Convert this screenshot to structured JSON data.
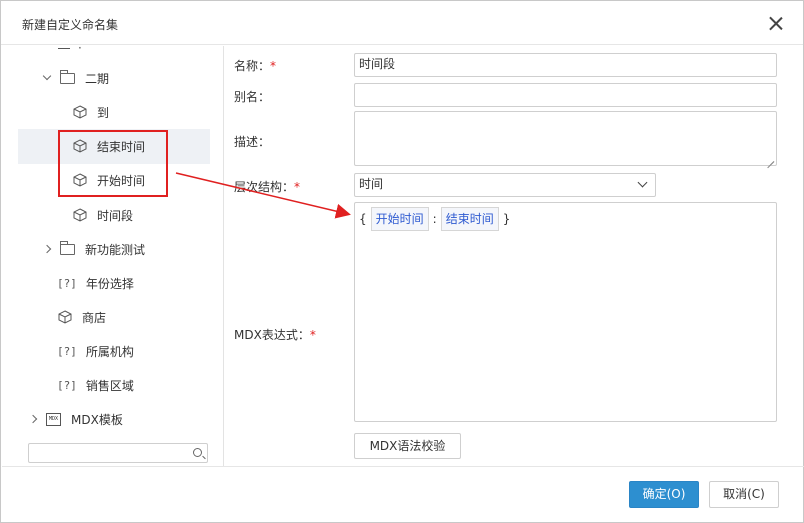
{
  "dialog": {
    "title": "新建自定义命名集",
    "close_label": "×"
  },
  "tree": {
    "items": [
      {
        "label": "二期",
        "icon": "folder-icon",
        "expanded": true
      },
      {
        "label": "到",
        "icon": "cube-icon"
      },
      {
        "label": "结束时间",
        "icon": "cube-icon",
        "selected": true
      },
      {
        "label": "开始时间",
        "icon": "cube-icon"
      },
      {
        "label": "时间段",
        "icon": "cube-icon"
      },
      {
        "label": "新功能测试",
        "icon": "folder-icon",
        "expanded": false
      },
      {
        "label": "年份选择",
        "icon": "question-mark-icon",
        "icon_text": "[?]"
      },
      {
        "label": "商店",
        "icon": "cube-icon"
      },
      {
        "label": "所属机构",
        "icon": "question-mark-icon",
        "icon_text": "[?]"
      },
      {
        "label": "销售区域",
        "icon": "question-mark-icon",
        "icon_text": "[?]"
      },
      {
        "label": "MDX模板",
        "icon": "mdx-icon",
        "icon_text": "MDX",
        "expanded": false
      }
    ],
    "search_placeholder": ""
  },
  "form": {
    "name_label": "名称：",
    "name_value": "时间段",
    "alias_label": "别名：",
    "alias_value": "",
    "desc_label": "描述：",
    "desc_value": "",
    "hierarchy_label": "层次结构：",
    "hierarchy_value": "时间",
    "mdx_label": "MDX表达式：",
    "required_mark": "*",
    "mdx_open": "{",
    "mdx_tokens": [
      "开始时间",
      "结束时间"
    ],
    "mdx_separator": ":",
    "mdx_close": "}",
    "validate_label": "MDX语法校验"
  },
  "footer": {
    "ok_label": "确定(O)",
    "cancel_label": "取消(C)"
  },
  "colors": {
    "annotation": "#e02020",
    "primary": "#2d8fd0",
    "token_text": "#2f5bd1"
  }
}
